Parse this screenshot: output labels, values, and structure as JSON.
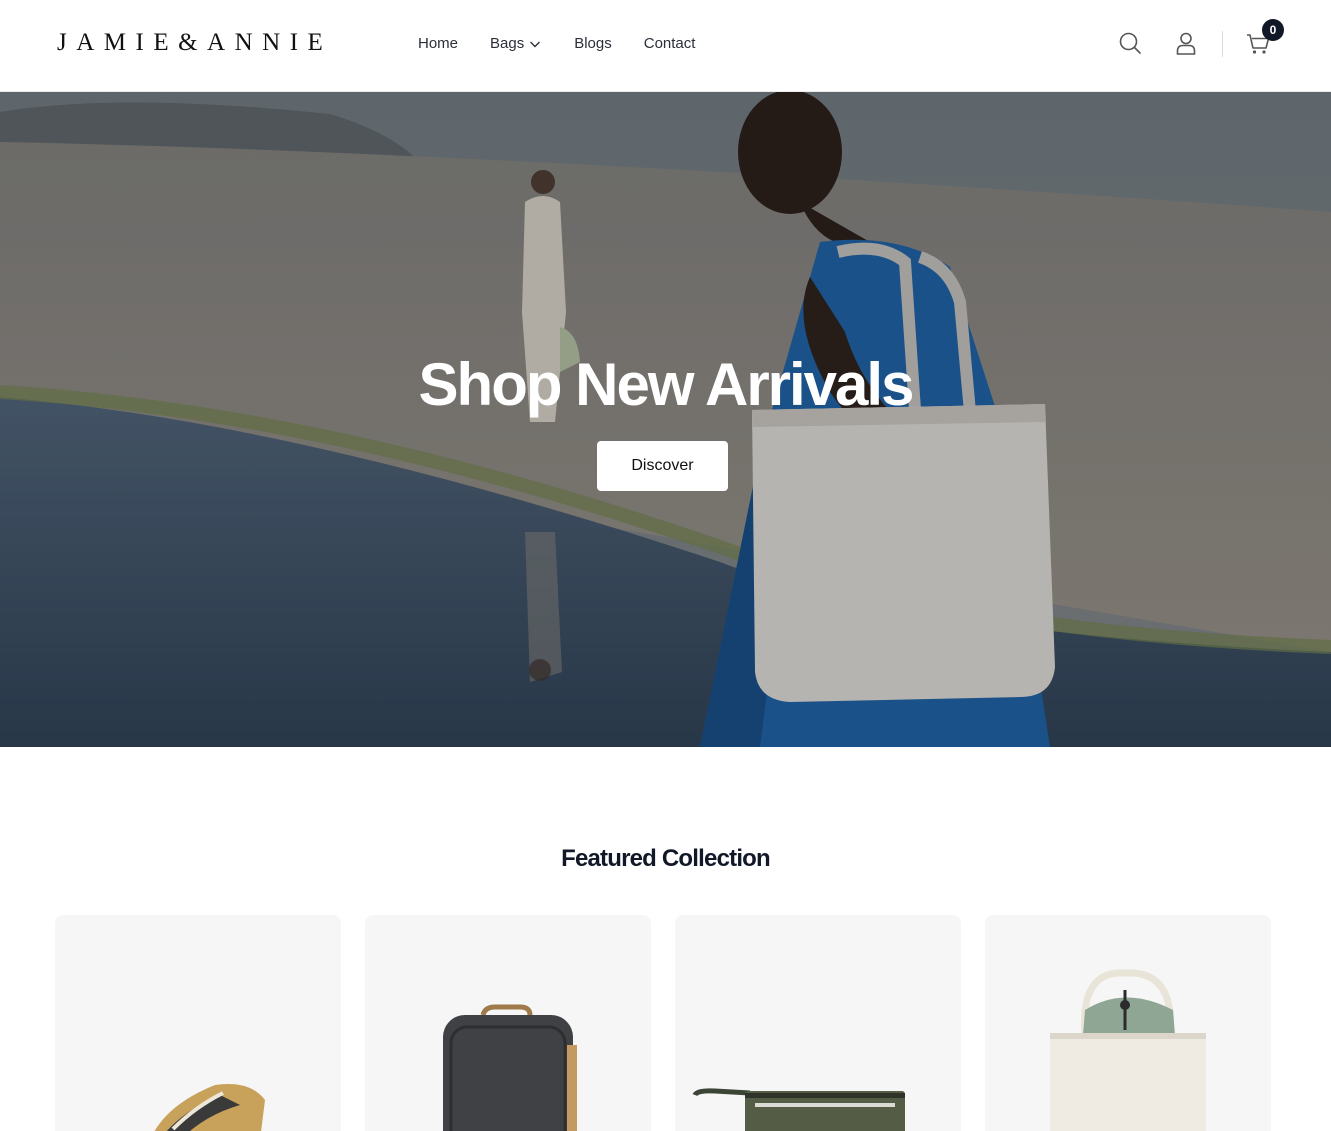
{
  "brand": {
    "logo_text": "JAMIE&ANNIE"
  },
  "nav": {
    "items": [
      {
        "label": "Home"
      },
      {
        "label": "Bags"
      },
      {
        "label": "Blogs"
      },
      {
        "label": "Contact"
      }
    ]
  },
  "header_icons": [
    "search-icon",
    "user-icon",
    "cart-icon"
  ],
  "cart": {
    "count": "0"
  },
  "hero": {
    "title": "Shop New Arrivals",
    "button_label": "Discover"
  },
  "featured": {
    "title": "Featured Collection",
    "products": [
      {
        "image": "tan-pouch-bag"
      },
      {
        "image": "charcoal-backpack"
      },
      {
        "image": "olive-clutch"
      },
      {
        "image": "cream-sage-tote"
      }
    ]
  },
  "colors": {
    "text_dark": "#111827",
    "badge": "#111827",
    "card_bg": "#f6f6f6",
    "button_bg": "#ffffff"
  }
}
